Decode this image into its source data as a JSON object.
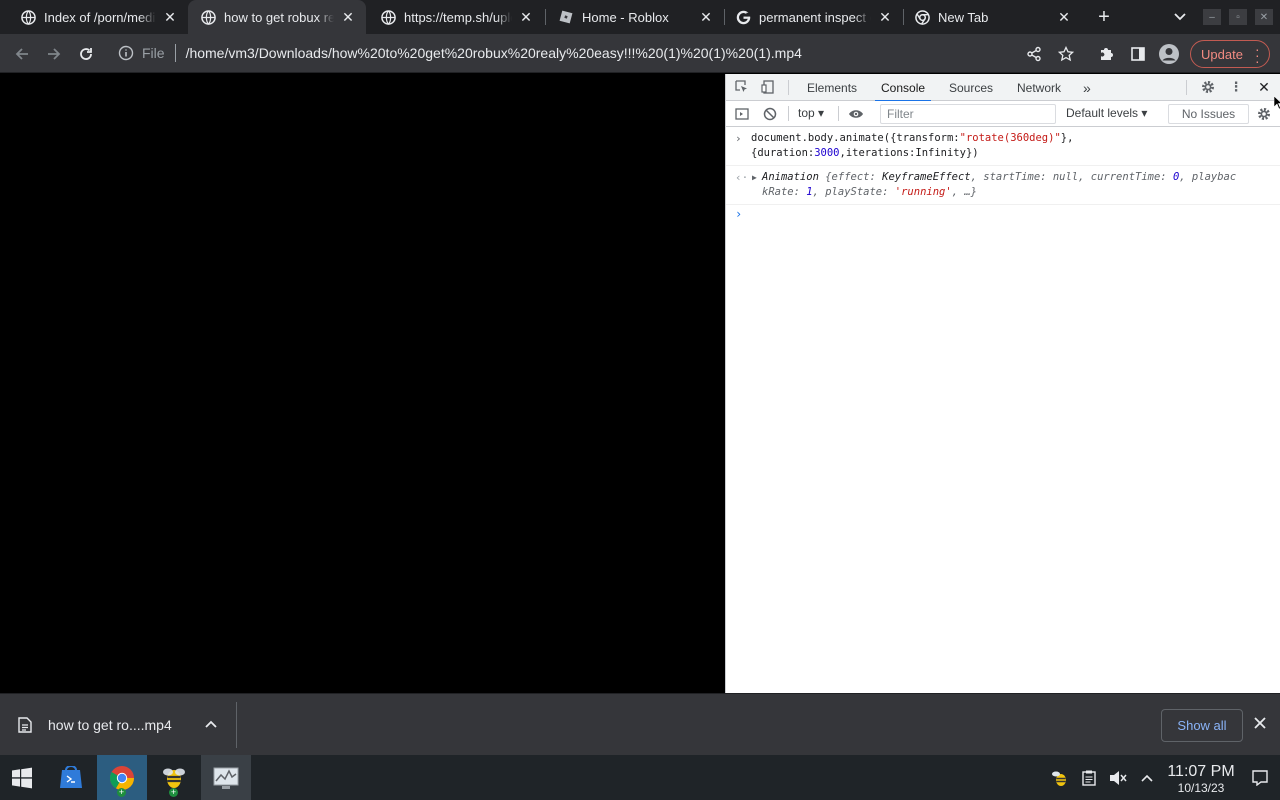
{
  "tabs": [
    {
      "title": "Index of /porn/media",
      "favicon": "globe-icon"
    },
    {
      "title": "how to get robux really easy",
      "favicon": "globe-icon"
    },
    {
      "title": "https://temp.sh/upload",
      "favicon": "globe-icon"
    },
    {
      "title": "Home - Roblox",
      "favicon": "roblox-icon"
    },
    {
      "title": "permanent inspect element",
      "favicon": "google-icon"
    },
    {
      "title": "New Tab",
      "favicon": "chrome-icon"
    }
  ],
  "toolbar": {
    "scheme": "File",
    "url": "/home/vm3/Downloads/how%20to%20get%20robux%20realy%20easy!!!%20(1)%20(1)%20(1).mp4",
    "update_label": "Update"
  },
  "devtools": {
    "tabs": [
      "Elements",
      "Console",
      "Sources",
      "Network"
    ],
    "more_label": "»",
    "context": "top ▾",
    "filter_placeholder": "Filter",
    "levels": "Default levels ▾",
    "issues": "No Issues",
    "console": {
      "input_line1_a": "document.body.animate({transform:",
      "input_line1_str": "\"rotate(360deg)\"",
      "input_line1_b": "},",
      "input_line2_a": "{duration:",
      "input_line2_num": "3000",
      "input_line2_b": ",iterations:Infinity})",
      "output_name": "Animation",
      "output_l1a": " {effect: ",
      "output_l1b": "KeyframeEffect",
      "output_l1c": ", startTime: ",
      "output_l1d": "null",
      "output_l1e": ", currentTime: ",
      "output_l1f": "0",
      "output_l1g": ", playbac",
      "output_l2a": "kRate: ",
      "output_l2b": "1",
      "output_l2c": ", playState: ",
      "output_l2d": "'running'",
      "output_l2e": ", …}"
    }
  },
  "download": {
    "filename": "how to get ro....mp4",
    "show_all": "Show all"
  },
  "taskbar": {
    "time": "11:07 PM",
    "date": "10/13/23"
  },
  "colors": {
    "accent": "#1a73e8",
    "update": "#f28b82",
    "taskbar_active": "#2c5d80"
  }
}
